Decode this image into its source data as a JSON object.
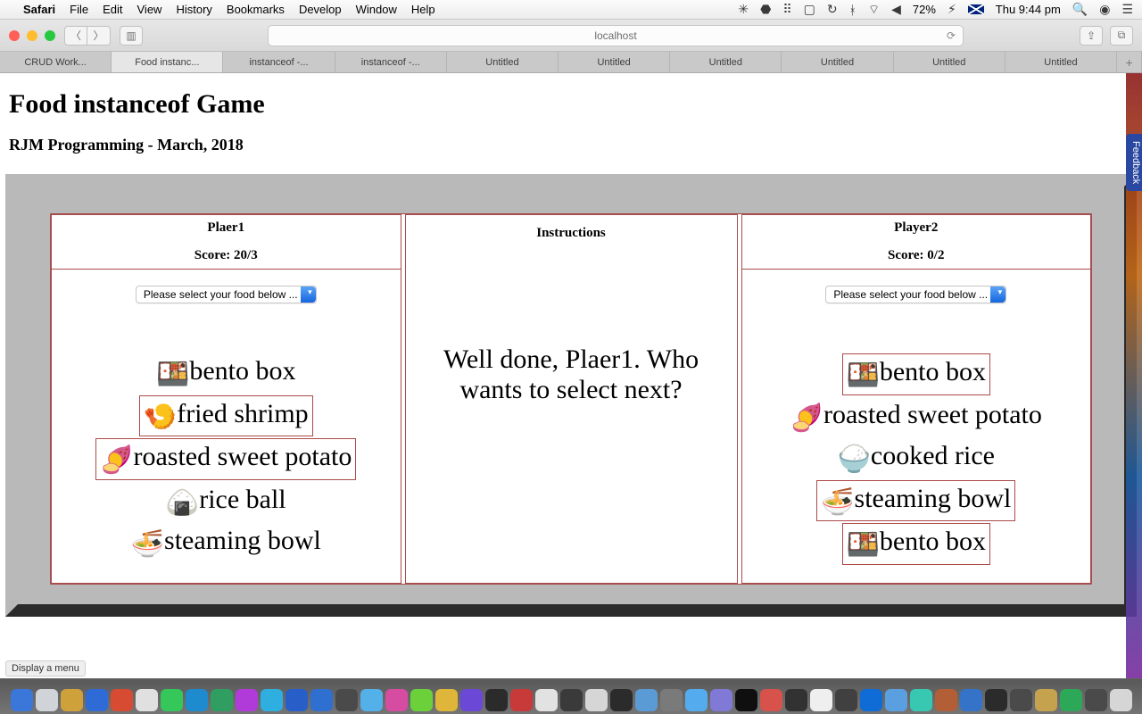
{
  "menubar": {
    "app": "Safari",
    "items": [
      "File",
      "Edit",
      "View",
      "History",
      "Bookmarks",
      "Develop",
      "Window",
      "Help"
    ],
    "battery": "72%",
    "clock": "Thu 9:44 pm"
  },
  "chrome": {
    "address": "localhost",
    "tabs": [
      "CRUD Work...",
      "Food instanc...",
      "instanceof -...",
      "instanceof -...",
      "Untitled",
      "Untitled",
      "Untitled",
      "Untitled",
      "Untitled",
      "Untitled"
    ],
    "active_tab_index": 1
  },
  "page": {
    "title": "Food instanceof Game",
    "subtitle": "RJM Programming - March, 2018",
    "statusbar": "Display a menu",
    "feedback_tab": "Feedback",
    "select_label": "Please select your food below ...",
    "players": {
      "p1": {
        "name": "Plaer1",
        "score_label": "Score: 20/3",
        "foods": [
          {
            "emoji": "🍱",
            "label": "bento box",
            "boxed": false
          },
          {
            "emoji": "🍤",
            "label": "fried shrimp",
            "boxed": true
          },
          {
            "emoji": "🍠",
            "label": "roasted sweet potato",
            "boxed": true
          },
          {
            "emoji": "🍙",
            "label": "rice ball",
            "boxed": false
          },
          {
            "emoji": "🍜",
            "label": "steaming bowl",
            "boxed": false
          }
        ]
      },
      "instructions": {
        "title": "Instructions",
        "body": "Well done, Plaer1. Who wants to select next?"
      },
      "p2": {
        "name": "Player2",
        "score_label": "Score: 0/2",
        "foods": [
          {
            "emoji": "🍱",
            "label": "bento box",
            "boxed": true
          },
          {
            "emoji": "🍠",
            "label": "roasted sweet potato",
            "boxed": false
          },
          {
            "emoji": "🍚",
            "label": "cooked rice",
            "boxed": false
          },
          {
            "emoji": "🍜",
            "label": "steaming bowl",
            "boxed": true
          },
          {
            "emoji": "🍱",
            "label": "bento box",
            "boxed": true
          }
        ]
      }
    }
  },
  "dock_colors": [
    "#3a77d8",
    "#d0d3d7",
    "#cfa13a",
    "#2e6bd6",
    "#d84b33",
    "#e0e0e0",
    "#35c759",
    "#1f8bcf",
    "#2f9e60",
    "#b03bd8",
    "#2faee0",
    "#285ec7",
    "#2f6fd0",
    "#4a4a4a",
    "#53b0e8",
    "#d64ca0",
    "#6bd03a",
    "#e0b63a",
    "#6b48d6",
    "#2b2b2b",
    "#c83a3a",
    "#e2e2e2",
    "#3a3a3a",
    "#d6d6d6",
    "#2b2b2b",
    "#5b9bd5",
    "#7a7a7a",
    "#54acee",
    "#8079d6",
    "#0f0f0f",
    "#d6524a",
    "#323232",
    "#efefef",
    "#404040",
    "#0f6bd6",
    "#5aa0e0",
    "#38c7b0",
    "#b25e36",
    "#3473c7",
    "#2b2b2b",
    "#4a4a4a",
    "#c4a24e",
    "#2da858",
    "#4a4a4a",
    "#d6d6d6"
  ]
}
